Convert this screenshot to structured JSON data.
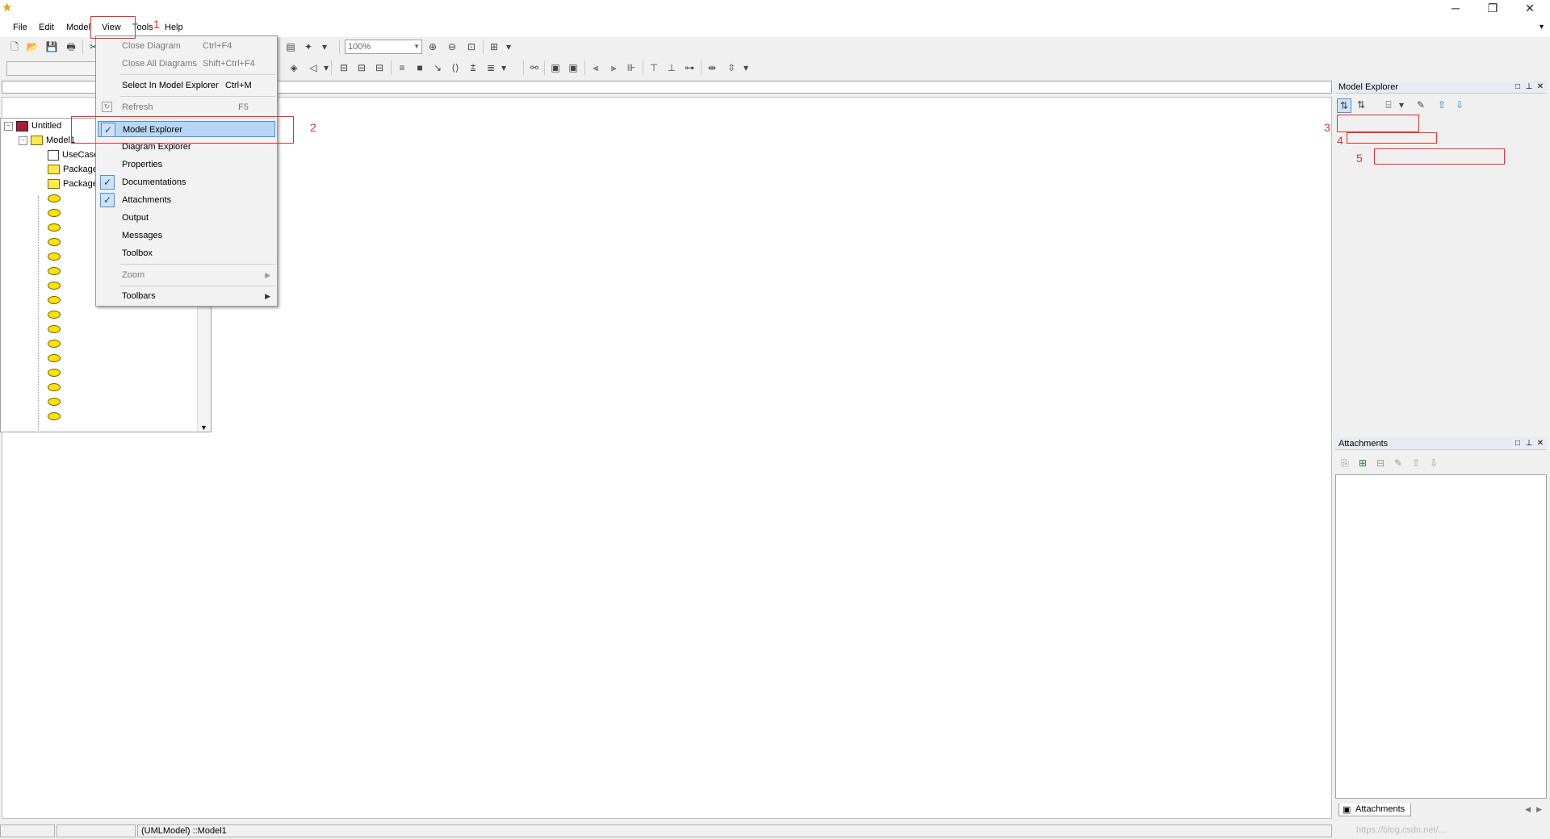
{
  "window": {
    "minimize_glyph": "─",
    "restore_glyph": "❐",
    "close_glyph": "✕"
  },
  "menubar": {
    "items": [
      {
        "label": "File"
      },
      {
        "label": "Edit"
      },
      {
        "label": "Model"
      },
      {
        "label": "View"
      },
      {
        "label": "Tools"
      },
      {
        "label": "Help"
      }
    ]
  },
  "toolbar": {
    "zoom_value": "100%"
  },
  "view_menu": {
    "close_diagram": {
      "label": "Close Diagram",
      "shortcut": "Ctrl+F4",
      "enabled": false
    },
    "close_all_diagrams": {
      "label": "Close All Diagrams",
      "shortcut": "Shift+Ctrl+F4",
      "enabled": false
    },
    "select_in_model_explorer": {
      "label": "Select In Model Explorer",
      "shortcut": "Ctrl+M"
    },
    "refresh": {
      "label": "Refresh",
      "shortcut": "F5",
      "enabled": false
    },
    "model_explorer": {
      "label": "Model Explorer",
      "checked": true
    },
    "diagram_explorer": {
      "label": "Diagram Explorer"
    },
    "properties": {
      "label": "Properties"
    },
    "documentations": {
      "label": "Documentations",
      "checked": true
    },
    "attachments": {
      "label": "Attachments",
      "checked": true
    },
    "output": {
      "label": "Output"
    },
    "messages": {
      "label": "Messages"
    },
    "toolbox": {
      "label": "Toolbox"
    },
    "zoom": {
      "label": "Zoom",
      "enabled": false
    },
    "toolbars": {
      "label": "Toolbars"
    }
  },
  "model_explorer": {
    "title": "Model Explorer",
    "tree": {
      "root": "Untitled",
      "model": "Model1",
      "diagram": "UseCaseDiagram1",
      "packages": [
        "Package1",
        "Package2"
      ]
    }
  },
  "attachments": {
    "title": "Attachments",
    "tab_label": "Attachments"
  },
  "status": {
    "cell1": "",
    "cell2": "",
    "selection": "(UMLModel) ::Model1",
    "watermark": "https://blog.csdn.net/..."
  },
  "annotations": [
    "1",
    "2",
    "3",
    "4",
    "5"
  ],
  "colors": {
    "annotation": "#e23030",
    "highlight": "#b6d7f5",
    "check_bg": "#cde2f7"
  }
}
